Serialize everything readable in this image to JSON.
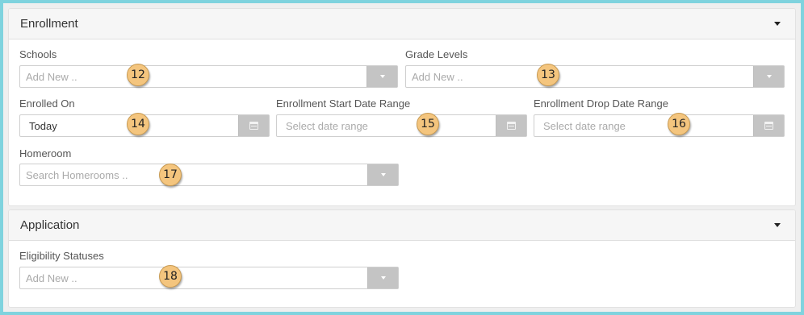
{
  "enrollment": {
    "title": "Enrollment",
    "schools": {
      "label": "Schools",
      "placeholder": "Add New ..",
      "badge": "12"
    },
    "grade_levels": {
      "label": "Grade Levels",
      "placeholder": "Add New ..",
      "badge": "13"
    },
    "enrolled_on": {
      "label": "Enrolled On",
      "value": "Today",
      "badge": "14"
    },
    "start_range": {
      "label": "Enrollment Start Date Range",
      "placeholder": "Select date range",
      "badge": "15"
    },
    "drop_range": {
      "label": "Enrollment Drop Date Range",
      "placeholder": "Select date range",
      "badge": "16"
    },
    "homeroom": {
      "label": "Homeroom",
      "placeholder": "Search Homerooms ..",
      "badge": "17"
    }
  },
  "application": {
    "title": "Application",
    "eligibility": {
      "label": "Eligibility Statuses",
      "placeholder": "Add New ..",
      "badge": "18"
    }
  },
  "colors": {
    "page_border": "#7fd3de",
    "badge": "#f4c57e",
    "addon": "#c4c4c4"
  }
}
